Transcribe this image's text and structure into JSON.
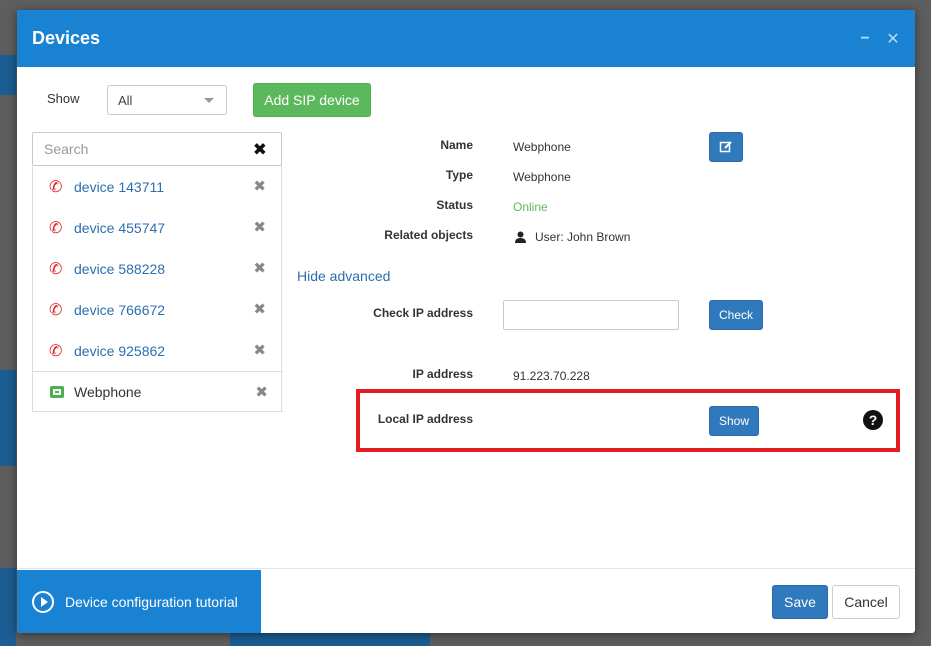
{
  "modal": {
    "title": "Devices",
    "minimize_icon": "minus-icon",
    "close_icon": "close-icon"
  },
  "toolbar": {
    "show_label": "Show",
    "show_value": "All",
    "add_button": "Add SIP device"
  },
  "search": {
    "placeholder": "Search",
    "value": ""
  },
  "devices": [
    {
      "name": "device 143711",
      "icon": "phone-icon"
    },
    {
      "name": "device 455747",
      "icon": "phone-icon"
    },
    {
      "name": "device 588228",
      "icon": "phone-icon"
    },
    {
      "name": "device 766672",
      "icon": "phone-icon"
    },
    {
      "name": "device 925862",
      "icon": "phone-icon"
    },
    {
      "name": "Webphone",
      "icon": "webphone-icon"
    }
  ],
  "details": {
    "name_label": "Name",
    "name_value": "Webphone",
    "type_label": "Type",
    "type_value": "Webphone",
    "status_label": "Status",
    "status_value": "Online",
    "related_label": "Related objects",
    "related_value": "User: John Brown",
    "advanced_link": "Hide advanced",
    "check_ip_label": "Check IP address",
    "check_ip_value": "",
    "check_button": "Check",
    "ip_label": "IP address",
    "ip_value": "91.223.70.228",
    "local_ip_label": "Local IP address",
    "show_button": "Show",
    "help_icon": "?"
  },
  "footer": {
    "tutorial": "Device configuration tutorial",
    "save": "Save",
    "cancel": "Cancel"
  },
  "colors": {
    "header": "#1a82d2",
    "primary_button": "#3079bd",
    "success_button": "#5cb85c",
    "online_status": "#5cb85c",
    "phone_icon": "#e02020",
    "highlight_border": "#e31b23"
  }
}
